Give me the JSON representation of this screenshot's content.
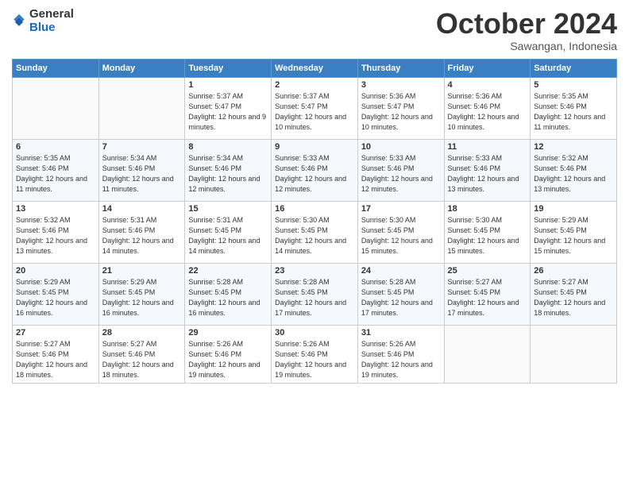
{
  "logo": {
    "general": "General",
    "blue": "Blue"
  },
  "header": {
    "month": "October 2024",
    "location": "Sawangan, Indonesia"
  },
  "days_of_week": [
    "Sunday",
    "Monday",
    "Tuesday",
    "Wednesday",
    "Thursday",
    "Friday",
    "Saturday"
  ],
  "weeks": [
    [
      {
        "day": "",
        "sunrise": "",
        "sunset": "",
        "daylight": ""
      },
      {
        "day": "",
        "sunrise": "",
        "sunset": "",
        "daylight": ""
      },
      {
        "day": "1",
        "sunrise": "Sunrise: 5:37 AM",
        "sunset": "Sunset: 5:47 PM",
        "daylight": "Daylight: 12 hours and 9 minutes."
      },
      {
        "day": "2",
        "sunrise": "Sunrise: 5:37 AM",
        "sunset": "Sunset: 5:47 PM",
        "daylight": "Daylight: 12 hours and 10 minutes."
      },
      {
        "day": "3",
        "sunrise": "Sunrise: 5:36 AM",
        "sunset": "Sunset: 5:47 PM",
        "daylight": "Daylight: 12 hours and 10 minutes."
      },
      {
        "day": "4",
        "sunrise": "Sunrise: 5:36 AM",
        "sunset": "Sunset: 5:46 PM",
        "daylight": "Daylight: 12 hours and 10 minutes."
      },
      {
        "day": "5",
        "sunrise": "Sunrise: 5:35 AM",
        "sunset": "Sunset: 5:46 PM",
        "daylight": "Daylight: 12 hours and 11 minutes."
      }
    ],
    [
      {
        "day": "6",
        "sunrise": "Sunrise: 5:35 AM",
        "sunset": "Sunset: 5:46 PM",
        "daylight": "Daylight: 12 hours and 11 minutes."
      },
      {
        "day": "7",
        "sunrise": "Sunrise: 5:34 AM",
        "sunset": "Sunset: 5:46 PM",
        "daylight": "Daylight: 12 hours and 11 minutes."
      },
      {
        "day": "8",
        "sunrise": "Sunrise: 5:34 AM",
        "sunset": "Sunset: 5:46 PM",
        "daylight": "Daylight: 12 hours and 12 minutes."
      },
      {
        "day": "9",
        "sunrise": "Sunrise: 5:33 AM",
        "sunset": "Sunset: 5:46 PM",
        "daylight": "Daylight: 12 hours and 12 minutes."
      },
      {
        "day": "10",
        "sunrise": "Sunrise: 5:33 AM",
        "sunset": "Sunset: 5:46 PM",
        "daylight": "Daylight: 12 hours and 12 minutes."
      },
      {
        "day": "11",
        "sunrise": "Sunrise: 5:33 AM",
        "sunset": "Sunset: 5:46 PM",
        "daylight": "Daylight: 12 hours and 13 minutes."
      },
      {
        "day": "12",
        "sunrise": "Sunrise: 5:32 AM",
        "sunset": "Sunset: 5:46 PM",
        "daylight": "Daylight: 12 hours and 13 minutes."
      }
    ],
    [
      {
        "day": "13",
        "sunrise": "Sunrise: 5:32 AM",
        "sunset": "Sunset: 5:46 PM",
        "daylight": "Daylight: 12 hours and 13 minutes."
      },
      {
        "day": "14",
        "sunrise": "Sunrise: 5:31 AM",
        "sunset": "Sunset: 5:46 PM",
        "daylight": "Daylight: 12 hours and 14 minutes."
      },
      {
        "day": "15",
        "sunrise": "Sunrise: 5:31 AM",
        "sunset": "Sunset: 5:45 PM",
        "daylight": "Daylight: 12 hours and 14 minutes."
      },
      {
        "day": "16",
        "sunrise": "Sunrise: 5:30 AM",
        "sunset": "Sunset: 5:45 PM",
        "daylight": "Daylight: 12 hours and 14 minutes."
      },
      {
        "day": "17",
        "sunrise": "Sunrise: 5:30 AM",
        "sunset": "Sunset: 5:45 PM",
        "daylight": "Daylight: 12 hours and 15 minutes."
      },
      {
        "day": "18",
        "sunrise": "Sunrise: 5:30 AM",
        "sunset": "Sunset: 5:45 PM",
        "daylight": "Daylight: 12 hours and 15 minutes."
      },
      {
        "day": "19",
        "sunrise": "Sunrise: 5:29 AM",
        "sunset": "Sunset: 5:45 PM",
        "daylight": "Daylight: 12 hours and 15 minutes."
      }
    ],
    [
      {
        "day": "20",
        "sunrise": "Sunrise: 5:29 AM",
        "sunset": "Sunset: 5:45 PM",
        "daylight": "Daylight: 12 hours and 16 minutes."
      },
      {
        "day": "21",
        "sunrise": "Sunrise: 5:29 AM",
        "sunset": "Sunset: 5:45 PM",
        "daylight": "Daylight: 12 hours and 16 minutes."
      },
      {
        "day": "22",
        "sunrise": "Sunrise: 5:28 AM",
        "sunset": "Sunset: 5:45 PM",
        "daylight": "Daylight: 12 hours and 16 minutes."
      },
      {
        "day": "23",
        "sunrise": "Sunrise: 5:28 AM",
        "sunset": "Sunset: 5:45 PM",
        "daylight": "Daylight: 12 hours and 17 minutes."
      },
      {
        "day": "24",
        "sunrise": "Sunrise: 5:28 AM",
        "sunset": "Sunset: 5:45 PM",
        "daylight": "Daylight: 12 hours and 17 minutes."
      },
      {
        "day": "25",
        "sunrise": "Sunrise: 5:27 AM",
        "sunset": "Sunset: 5:45 PM",
        "daylight": "Daylight: 12 hours and 17 minutes."
      },
      {
        "day": "26",
        "sunrise": "Sunrise: 5:27 AM",
        "sunset": "Sunset: 5:45 PM",
        "daylight": "Daylight: 12 hours and 18 minutes."
      }
    ],
    [
      {
        "day": "27",
        "sunrise": "Sunrise: 5:27 AM",
        "sunset": "Sunset: 5:46 PM",
        "daylight": "Daylight: 12 hours and 18 minutes."
      },
      {
        "day": "28",
        "sunrise": "Sunrise: 5:27 AM",
        "sunset": "Sunset: 5:46 PM",
        "daylight": "Daylight: 12 hours and 18 minutes."
      },
      {
        "day": "29",
        "sunrise": "Sunrise: 5:26 AM",
        "sunset": "Sunset: 5:46 PM",
        "daylight": "Daylight: 12 hours and 19 minutes."
      },
      {
        "day": "30",
        "sunrise": "Sunrise: 5:26 AM",
        "sunset": "Sunset: 5:46 PM",
        "daylight": "Daylight: 12 hours and 19 minutes."
      },
      {
        "day": "31",
        "sunrise": "Sunrise: 5:26 AM",
        "sunset": "Sunset: 5:46 PM",
        "daylight": "Daylight: 12 hours and 19 minutes."
      },
      {
        "day": "",
        "sunrise": "",
        "sunset": "",
        "daylight": ""
      },
      {
        "day": "",
        "sunrise": "",
        "sunset": "",
        "daylight": ""
      }
    ]
  ]
}
